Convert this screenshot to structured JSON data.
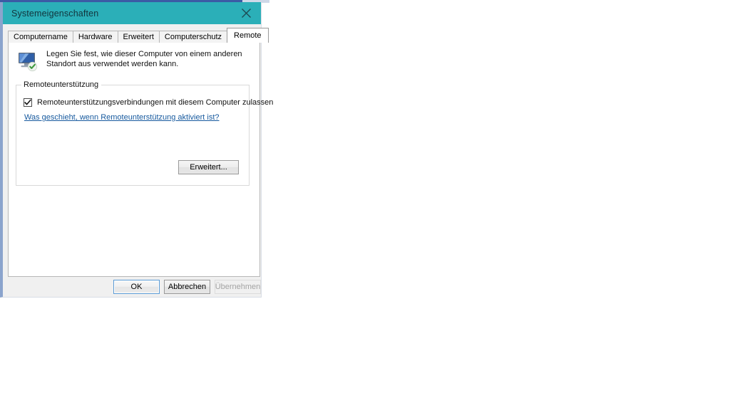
{
  "window": {
    "title": "Systemeigenschaften",
    "close_icon": "close-icon"
  },
  "tabs": [
    {
      "label": "Computername",
      "active": false
    },
    {
      "label": "Hardware",
      "active": false
    },
    {
      "label": "Erweitert",
      "active": false
    },
    {
      "label": "Computerschutz",
      "active": false
    },
    {
      "label": "Remote",
      "active": true
    }
  ],
  "panel": {
    "icon": "remote-computer-icon",
    "description": "Legen Sie fest, wie dieser Computer von einem anderen Standort aus verwendet werden kann.",
    "group": {
      "legend": "Remoteunterstützung",
      "checkbox": {
        "label": "Remoteunterstützungsverbindungen mit diesem Computer zulassen",
        "checked": true
      },
      "link": "Was geschieht, wenn Remoteunterstützung aktiviert ist?",
      "advanced_button": "Erweitert..."
    }
  },
  "buttons": {
    "ok": "OK",
    "cancel": "Abbrechen",
    "apply": "Übernehmen",
    "apply_disabled": true
  },
  "colors": {
    "titlebar": "#2bafb8",
    "link": "#16599e",
    "dialog_bg": "#f0f0f0",
    "panel_bg": "#ffffff",
    "focus_border": "#5b9bd5"
  }
}
